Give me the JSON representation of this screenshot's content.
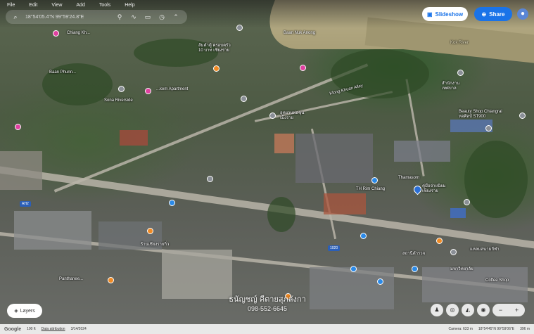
{
  "menu": [
    "File",
    "Edit",
    "View",
    "Add",
    "Tools",
    "Help"
  ],
  "search": {
    "coords": "18°54'05.4\"N 99°59'24.8\"E"
  },
  "toolbar_icons": [
    "location-pin-icon",
    "path-icon",
    "image-icon",
    "history-icon",
    "chevron-icon"
  ],
  "buttons": {
    "slideshow": "Slideshow",
    "share": "Share"
  },
  "map_labels": [
    "Chiang Kh...",
    "Baan Nuk Anong",
    "Kok River",
    "ส้มตำตู้ ครอบครัว\n10 บาท เชียงราย",
    "Baan Phunn...",
    "...kem Apartment",
    "Sona Riverside",
    "Klong Khuan Alley",
    "อุทยานพ่อขุน\nเม็งราย",
    "สำนักงาน\nเทศบาล",
    "คู่มือจ่ายนิยม\nเชียงราย",
    "Beauty Shop Chiangrai\nหอศิลป์ ST900",
    "TH Rim Chiang",
    "Thamasorn",
    "ร้านเชียงรายกิ่ว",
    "Panthanee...",
    "สถานีตำรวจ",
    "แหลมสนามกีฬา",
    "มหาวิทยาลัย",
    "Coffee Shop",
    "1020",
    "AH2"
  ],
  "watermark": {
    "name": "ธนัญชญ์ คีตายสุภลังกา",
    "phone": "098-552-6645"
  },
  "layers_label": "Layers",
  "zoom": {
    "minus": "−",
    "plus": "+"
  },
  "ctrl_icons": [
    "street-view-icon",
    "compass-icon",
    "tilt-icon",
    "location-icon"
  ],
  "footer": {
    "google": "Google",
    "items": [
      "100 ft",
      "Data attribution",
      "3/14/2024"
    ],
    "right": [
      "Camera: 633 m",
      "18°54'45\"N 99°59'06\"E",
      "396 m"
    ]
  },
  "colors": {
    "accent": "#1a73e8",
    "pin_pink": "#e040a0",
    "pin_orange": "#f08a24",
    "pin_blue": "#2b8ae8",
    "pin_gray": "#8a8f96"
  }
}
